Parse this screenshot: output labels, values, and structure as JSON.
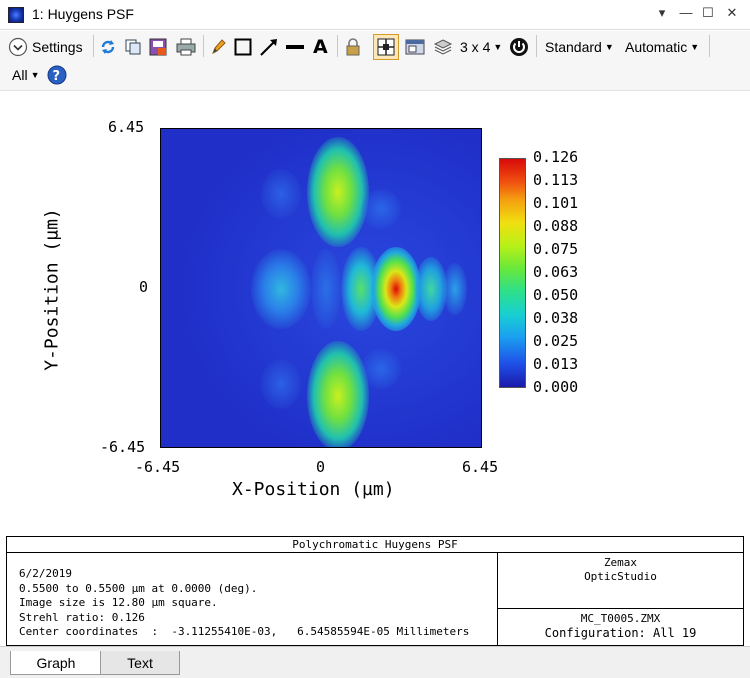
{
  "window": {
    "title": "1: Huygens PSF"
  },
  "toolbar": {
    "settings_label": "Settings",
    "layout_label": "3 x 4",
    "standard_label": "Standard",
    "automatic_label": "Automatic",
    "all_label": "All",
    "icons": [
      "refresh-icon",
      "copy-icon",
      "save-icon",
      "print-icon",
      "pencil-icon",
      "rectangle-icon",
      "arrow-icon",
      "line-icon",
      "text-icon",
      "lock-icon",
      "crosshair-icon",
      "window-icon",
      "layers-icon",
      "power-icon",
      "help-icon"
    ]
  },
  "plot": {
    "y_ticks": [
      "6.45",
      "0",
      "-6.45"
    ],
    "x_ticks": [
      "-6.45",
      "0",
      "6.45"
    ],
    "x_title": "X-Position (µm)",
    "y_title": "Y-Position (µm)",
    "colorbar_labels": [
      "0.126",
      "0.113",
      "0.101",
      "0.088",
      "0.075",
      "0.063",
      "0.050",
      "0.038",
      "0.025",
      "0.013",
      "0.000"
    ]
  },
  "info": {
    "title": "Polychromatic Huygens PSF",
    "lines": [
      "6/2/2019",
      "0.5500 to 0.5500 µm at 0.0000 (deg).",
      "Image size is 12.80 µm square.",
      "Strehl ratio: 0.126",
      "Center coordinates  :  -3.11255410E-03,   6.54585594E-05 Millimeters"
    ],
    "company": "Zemax",
    "product": "OpticStudio",
    "file": "MC_T0005.ZMX",
    "config": "Configuration: All 19"
  },
  "tabs": {
    "graph": "Graph",
    "text": "Text"
  }
}
